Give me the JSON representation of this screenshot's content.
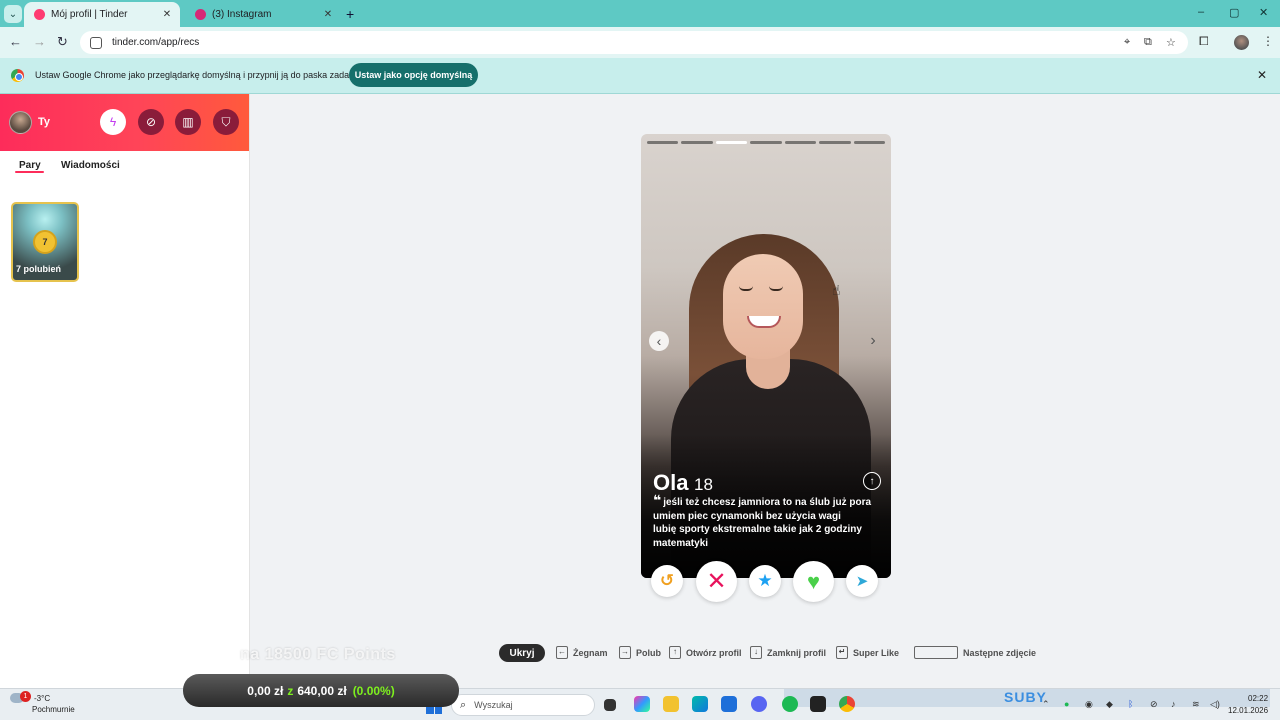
{
  "browser": {
    "tabs": [
      {
        "title": "Mój profil | Tinder",
        "favicon_color": "#fe3c72",
        "active": true
      },
      {
        "title": "(3) Instagram",
        "favicon_color": "#d62976",
        "active": false
      }
    ],
    "new_tab_label": "+",
    "url": "tinder.com/app/recs",
    "window_controls": {
      "minimize": "–",
      "maximize": "▢",
      "close": "✕"
    }
  },
  "infobar": {
    "message": "Ustaw Google Chrome jako przeglądarkę domyślną i przypnij ją do paska zadań",
    "button_label": "Ustaw jako opcję domyślną",
    "close_label": "✕"
  },
  "sidebar": {
    "user_name": "Ty",
    "header_icons": [
      "bolt-icon",
      "compass-icon",
      "briefcase-icon",
      "shield-icon"
    ],
    "tabs": [
      {
        "label": "Pary",
        "active": true
      },
      {
        "label": "Wiadomości",
        "active": false
      }
    ],
    "likes_card": {
      "count": "7",
      "label": "7 polubień"
    }
  },
  "profile": {
    "name": "Ola",
    "age": "18",
    "bio_lines": [
      "jeśli też chcesz jamniora to na ślub już pora",
      "umiem piec cynamonki bez użycia wagi",
      "lubię sporty ekstremalne takie jak 2 godziny",
      "matematyki"
    ],
    "photo_count": 7,
    "current_photo": 3
  },
  "actions": {
    "rewind": "↺",
    "nope": "✕",
    "super_like": "★",
    "like": "♥",
    "boost": "➤"
  },
  "shortcuts": {
    "hide_label": "Ukryj",
    "items": [
      {
        "key": "←",
        "label": "Żegnam"
      },
      {
        "key": "→",
        "label": "Polub"
      },
      {
        "key": "↑",
        "label": "Otwórz profil"
      },
      {
        "key": "↓",
        "label": "Zamknij profil"
      },
      {
        "key": "↵",
        "label": "Super Like"
      },
      {
        "key": "",
        "label": "Następne zdjęcie"
      }
    ]
  },
  "overlay": {
    "headline": "na 18500 FC Points",
    "donation_current": "0,00 zł",
    "donation_sep": "z",
    "donation_goal": "640,00 zł",
    "donation_pct": "(0.00%)"
  },
  "taskbar": {
    "notification_count": "1",
    "temperature": "-3°C",
    "condition": "Pochmurnie",
    "search_placeholder": "Wyszukaj",
    "subs_label": "SUBY",
    "clock_time": "02:22",
    "clock_date": "12.01.2026"
  }
}
